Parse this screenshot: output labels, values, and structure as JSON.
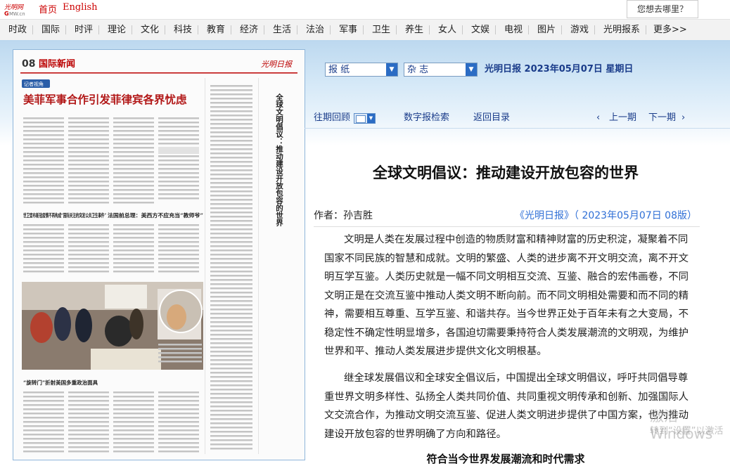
{
  "topbar": {
    "logo_text": "光明网 GMW.cn",
    "home": "首页",
    "english": "English",
    "search_hint": "您想去哪里？"
  },
  "nav": [
    "时政",
    "国际",
    "时评",
    "理论",
    "文化",
    "科技",
    "教育",
    "经济",
    "生活",
    "法治",
    "军事",
    "卫生",
    "养生",
    "女人",
    "文娱",
    "电视",
    "图片",
    "游戏",
    "光明报系",
    "更多>>"
  ],
  "selector": {
    "paper": "报  纸",
    "magazine": "杂  志",
    "paper_date": "光明日报  2023年05月07日  星期日"
  },
  "toolbar": {
    "past": "往期回顾",
    "search": "数字报检索",
    "back": "返回目录",
    "prev": "上一期",
    "next": "下一期"
  },
  "newspaper": {
    "page_no": "08",
    "section": "国际新闻",
    "masthead": "光明日报",
    "headline": "美菲军事合作引发菲律宾各界忧虑",
    "vertical_title": "全球文明倡议：推动建设开放包容的世界",
    "sub1": "世卫宣布新冠疫情不再构成“国际关注的突发公共卫生事件”",
    "sub2": "法国前总理：美西方不应充当“教师爷”",
    "sub3": "“旋转门”折射美国多重政治面具",
    "tag": "记者视角"
  },
  "article": {
    "title": "全球文明倡议：推动建设开放包容的世界",
    "author": "作者：孙吉胜",
    "source": "《光明日报》（ 2023年05月07日   08版）",
    "paragraphs": [
      "文明是人类在发展过程中创造的物质财富和精神财富的历史积淀，凝聚着不同国家不同民族的智慧和成就。文明的繁盛、人类的进步离不开文明交流，离不开文明互学互鉴。人类历史就是一幅不同文明相互交流、互鉴、融合的宏伟画卷，不同文明正是在交流互鉴中推动人类文明不断向前。而不同文明相处需要和而不同的精神，需要相互尊重、互学互鉴、和谐共存。当今世界正处于百年未有之大变局，不稳定性不确定性明显增多，各国迫切需要秉持符合人类发展潮流的文明观，为维护世界和平、推动人类发展进步提供文化文明根基。",
      "继全球发展倡议和全球安全倡议后，中国提出全球文明倡议，呼吁共同倡导尊重世界文明多样性、弘扬全人类共同价值、共同重视文明传承和创新、加强国际人文交流合作，为推动文明交流互鉴、促进人类文明进步提供了中国方案，也为推动建设开放包容的世界明确了方向和路径。"
    ],
    "subhead": "符合当今世界发展潮流和时代需求"
  },
  "watermark": {
    "line1": "激活 Windows",
    "line2": "转到“设置”以激活"
  },
  "colors": {
    "brand_red": "#c00000",
    "link_blue": "#2f6fd6",
    "nav_blue": "#1a3c8a"
  }
}
